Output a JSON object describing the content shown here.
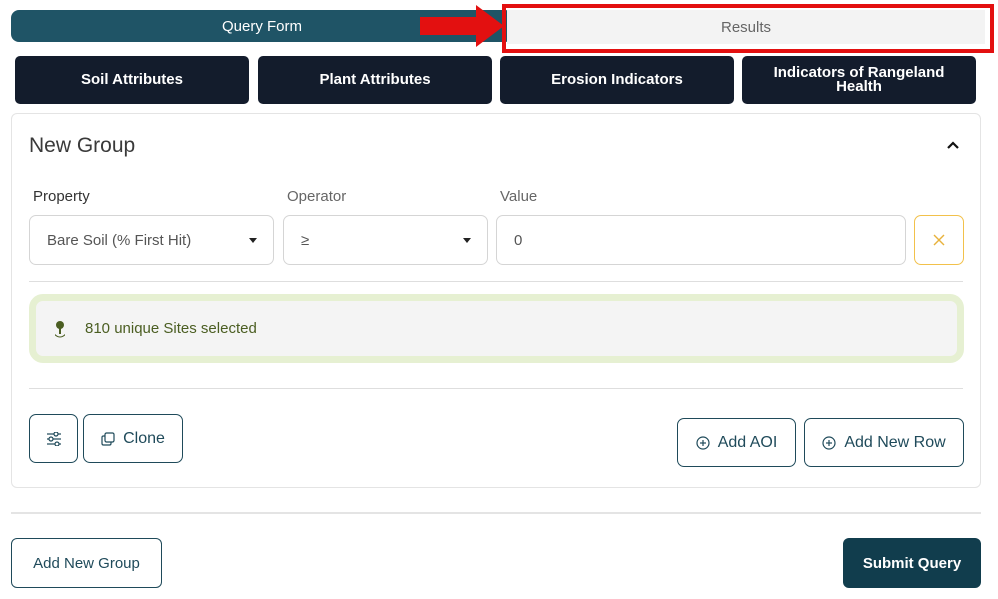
{
  "tabs": {
    "query_form": "Query Form",
    "results": "Results"
  },
  "categories": [
    "Soil Attributes",
    "Plant Attributes",
    "Erosion Indicators",
    "Indicators of Rangeland Health"
  ],
  "group": {
    "title": "New Group",
    "labels": {
      "property": "Property",
      "operator": "Operator",
      "value": "Value"
    },
    "row": {
      "property": "Bare Soil (% First Hit)",
      "operator": "≥",
      "value": "0"
    },
    "sites_info": "810 unique Sites selected",
    "buttons": {
      "clone": "Clone",
      "add_aoi": "Add AOI",
      "add_new_row": "Add New Row"
    }
  },
  "footer": {
    "add_new_group": "Add New Group",
    "submit_query": "Submit Query"
  },
  "colors": {
    "primary": "#1f5466",
    "dark_button": "#131c2c",
    "annotation_red": "#e31010",
    "warning_border": "#f2c14b",
    "sites_border": "#e6f0d2"
  },
  "icons": [
    "arrow-right-icon",
    "chevron-up-icon",
    "caret-down-icon",
    "close-icon",
    "map-pin-icon",
    "sliders-icon",
    "copy-icon",
    "plus-circle-icon"
  ]
}
